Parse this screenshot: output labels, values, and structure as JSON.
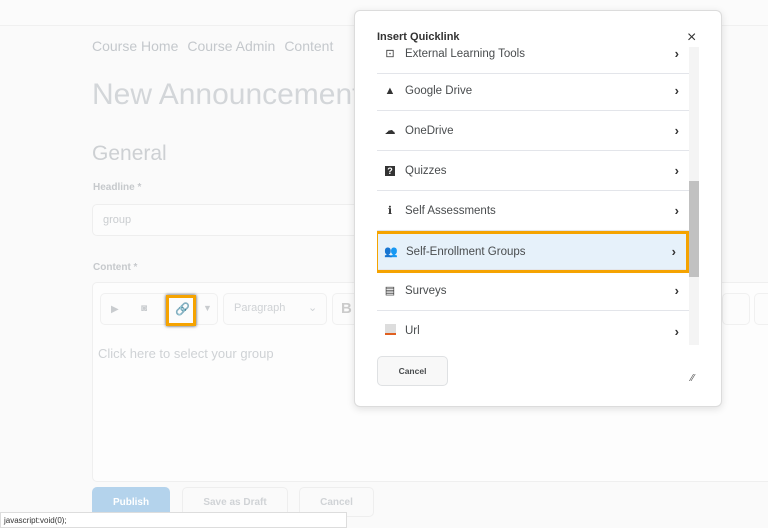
{
  "nav": [
    "Course Home",
    "Course Admin",
    "Content"
  ],
  "page": {
    "title": "New Announcement",
    "section": "General",
    "headline_label": "Headline *",
    "headline_value": "group",
    "content_label": "Content *",
    "format_select": "Paragraph",
    "bold": "B",
    "editor_placeholder": "Click here to select your group"
  },
  "footer": {
    "publish": "Publish",
    "save_draft": "Save as Draft",
    "cancel": "Cancel"
  },
  "status_bar": "javascript:void(0);",
  "dialog": {
    "title": "Insert Quicklink",
    "close": "×",
    "cancel": "Cancel",
    "items": [
      {
        "label": "External Learning Tools",
        "icon": "external-tool-icon"
      },
      {
        "label": "Google Drive",
        "icon": "google-drive-icon"
      },
      {
        "label": "OneDrive",
        "icon": "cloud-icon"
      },
      {
        "label": "Quizzes",
        "icon": "quiz-icon"
      },
      {
        "label": "Self Assessments",
        "icon": "self-assessment-icon"
      },
      {
        "label": "Self-Enrollment Groups",
        "icon": "groups-icon",
        "selected": true
      },
      {
        "label": "Surveys",
        "icon": "clipboard-icon"
      },
      {
        "label": "Url",
        "icon": "url-icon"
      }
    ]
  },
  "colors": {
    "highlight": "#f5a300",
    "selected_row": "#e6f1fa",
    "publish": "#b4d3ec"
  }
}
